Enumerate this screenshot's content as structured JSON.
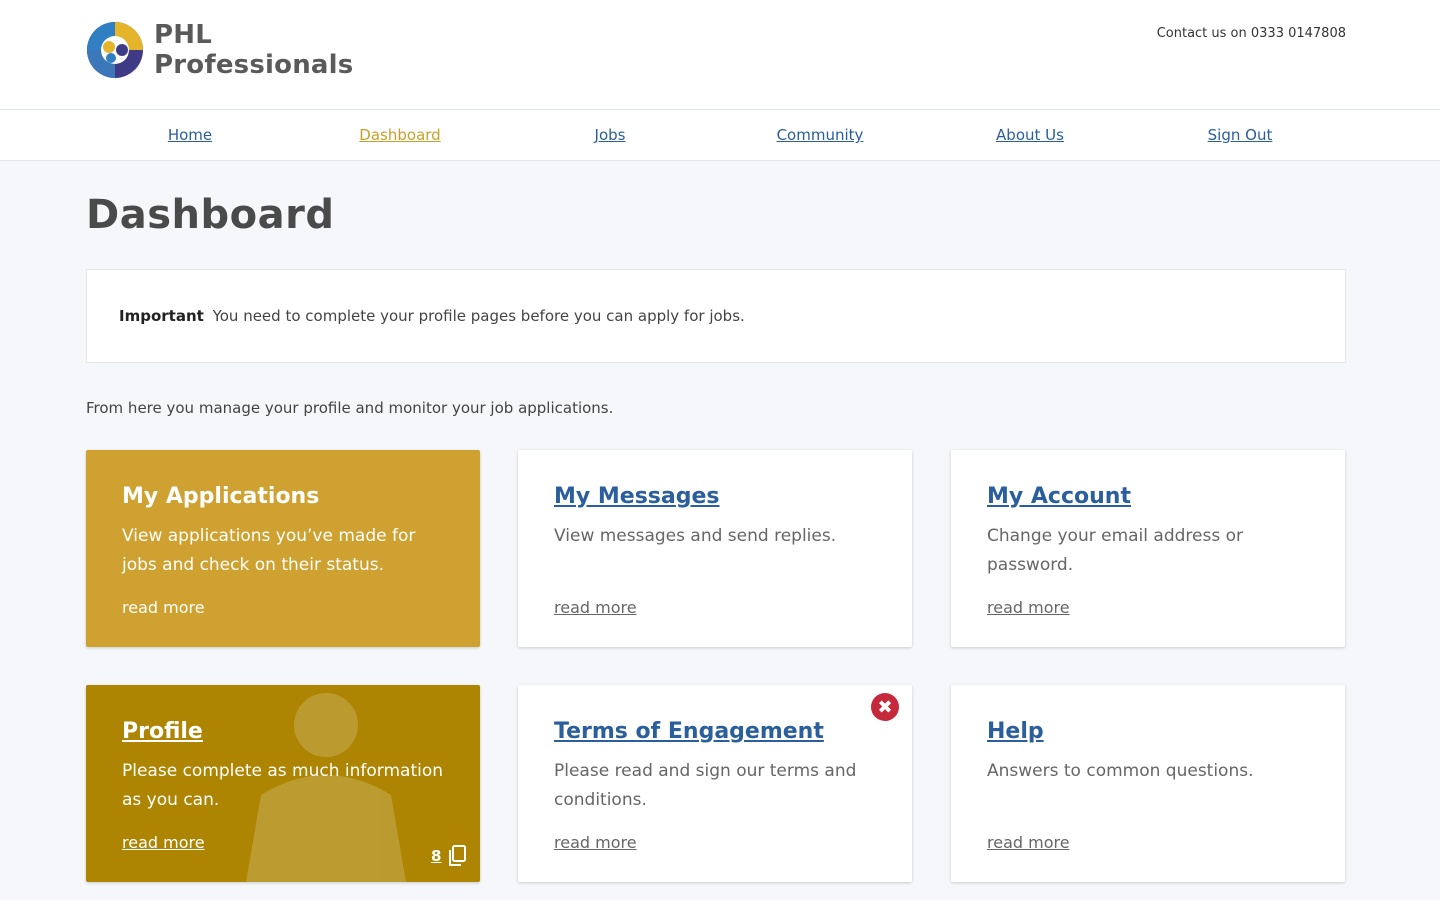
{
  "header": {
    "logo_line1": "PHL",
    "logo_line2": "Professionals",
    "contact": "Contact us on 0333 0147808"
  },
  "nav": {
    "items": [
      {
        "label": "Home",
        "active": false
      },
      {
        "label": "Dashboard",
        "active": true
      },
      {
        "label": "Jobs",
        "active": false
      },
      {
        "label": "Community",
        "active": false
      },
      {
        "label": "About Us",
        "active": false
      },
      {
        "label": "Sign Out",
        "active": false
      }
    ]
  },
  "main": {
    "title": "Dashboard",
    "notice": {
      "strong": "Important",
      "text": "You need to complete your profile pages before you can apply for jobs."
    },
    "intro": "From here you manage your profile and monitor your job applications.",
    "cards": [
      {
        "title": "My Applications",
        "desc": "View applications you’ve made for jobs and check on their status.",
        "more": "read more"
      },
      {
        "title": "My Messages",
        "desc": "View messages and send replies.",
        "more": "read more"
      },
      {
        "title": "My Account",
        "desc": "Change your email address or password.",
        "more": "read more"
      },
      {
        "title": "Profile",
        "desc": "Please complete as much information as you can.",
        "more": "read more",
        "count": "8"
      },
      {
        "title": "Terms of Engagement",
        "desc": "Please read and sign our terms and conditions.",
        "more": "read more",
        "badge": "✖"
      },
      {
        "title": "Help",
        "desc": "Answers to common questions.",
        "more": "read more"
      }
    ]
  },
  "colors": {
    "link": "#2a5e9c",
    "active_nav": "#c9a02b",
    "card_gold": "#cfa130",
    "card_olive": "#ad8502",
    "alert_badge": "#c42a3c"
  },
  "icons": [
    "logo-mark-icon",
    "close-circle-icon",
    "copy-icon"
  ]
}
